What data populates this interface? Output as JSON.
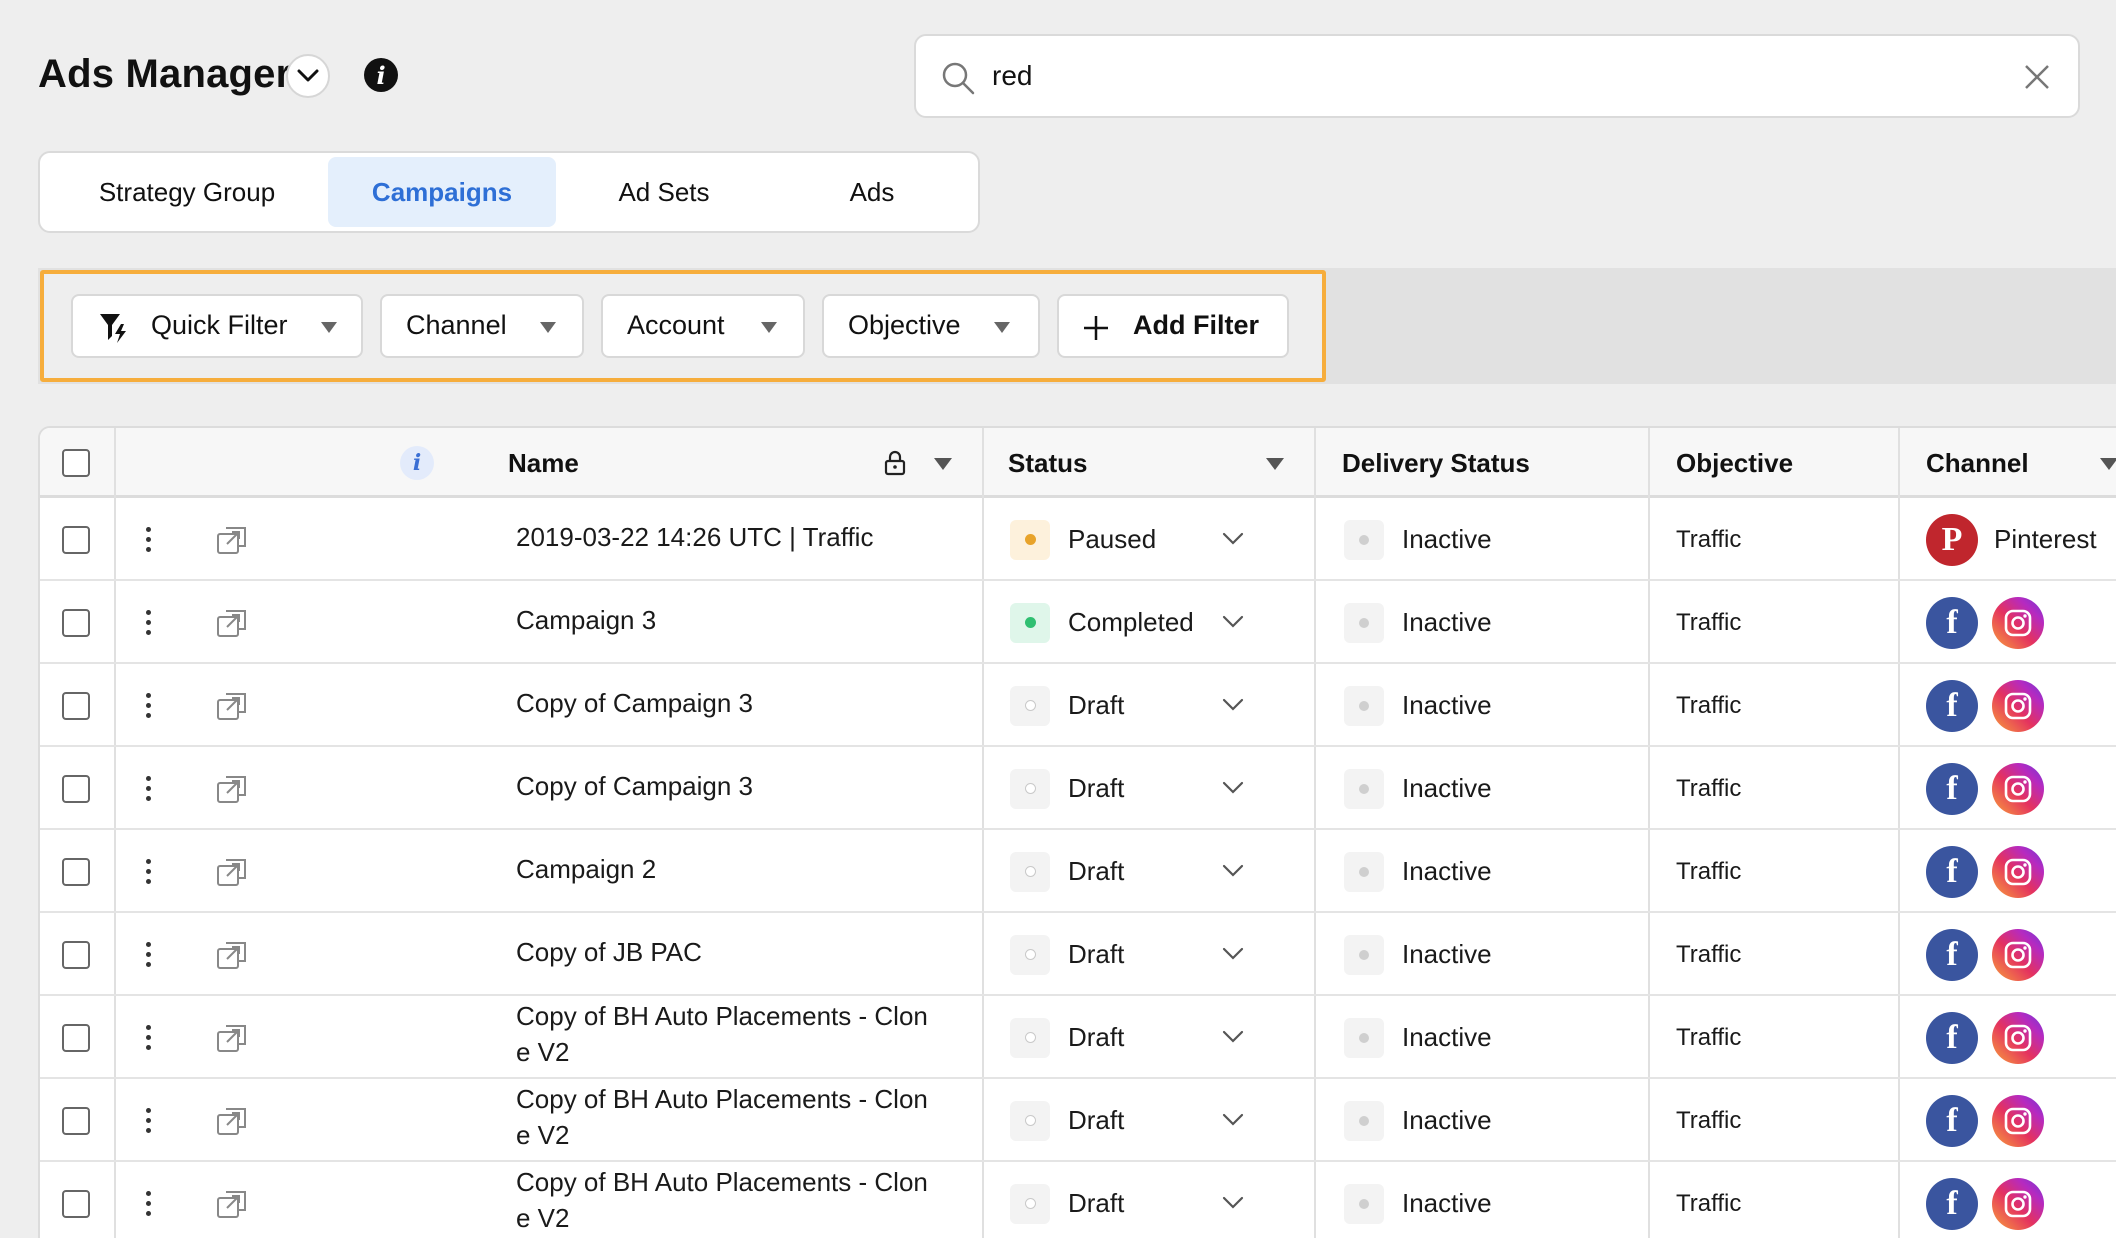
{
  "header": {
    "title": "Ads Manager",
    "search_value": "red"
  },
  "tabs": [
    {
      "label": "Strategy Group",
      "active": false
    },
    {
      "label": "Campaigns",
      "active": true
    },
    {
      "label": "Ad Sets",
      "active": false
    },
    {
      "label": "Ads",
      "active": false
    }
  ],
  "filters": {
    "quick_filter": "Quick Filter",
    "channel": "Channel",
    "account": "Account",
    "objective": "Objective",
    "add_filter": "Add Filter"
  },
  "table": {
    "columns": {
      "name": "Name",
      "status": "Status",
      "delivery_status": "Delivery Status",
      "objective": "Objective",
      "channel": "Channel"
    },
    "rows": [
      {
        "name_line1": "2019-03-22 14:26 UTC | Traffic",
        "name_line2": "",
        "status": "Paused",
        "status_kind": "paused",
        "delivery": "Inactive",
        "objective": "Traffic",
        "channel": "pinterest",
        "channel_label": "Pinterest"
      },
      {
        "name_line1": "Campaign 3",
        "name_line2": "",
        "status": "Completed",
        "status_kind": "completed",
        "delivery": "Inactive",
        "objective": "Traffic",
        "channel": "facebook-instagram",
        "channel_label": ""
      },
      {
        "name_line1": "Copy of Campaign 3",
        "name_line2": "",
        "status": "Draft",
        "status_kind": "draft",
        "delivery": "Inactive",
        "objective": "Traffic",
        "channel": "facebook-instagram",
        "channel_label": ""
      },
      {
        "name_line1": "Copy of Campaign 3",
        "name_line2": "",
        "status": "Draft",
        "status_kind": "draft",
        "delivery": "Inactive",
        "objective": "Traffic",
        "channel": "facebook-instagram",
        "channel_label": ""
      },
      {
        "name_line1": "Campaign 2",
        "name_line2": "",
        "status": "Draft",
        "status_kind": "draft",
        "delivery": "Inactive",
        "objective": "Traffic",
        "channel": "facebook-instagram",
        "channel_label": ""
      },
      {
        "name_line1": "Copy of JB PAC",
        "name_line2": "",
        "status": "Draft",
        "status_kind": "draft",
        "delivery": "Inactive",
        "objective": "Traffic",
        "channel": "facebook-instagram",
        "channel_label": ""
      },
      {
        "name_line1": "Copy of BH Auto Placements - Clon",
        "name_line2": "e V2",
        "status": "Draft",
        "status_kind": "draft",
        "delivery": "Inactive",
        "objective": "Traffic",
        "channel": "facebook-instagram",
        "channel_label": ""
      },
      {
        "name_line1": "Copy of BH Auto Placements - Clon",
        "name_line2": "e V2",
        "status": "Draft",
        "status_kind": "draft",
        "delivery": "Inactive",
        "objective": "Traffic",
        "channel": "facebook-instagram",
        "channel_label": ""
      },
      {
        "name_line1": "Copy of BH Auto Placements - Clon",
        "name_line2": "e V2",
        "status": "Draft",
        "status_kind": "draft",
        "delivery": "Inactive",
        "objective": "Traffic",
        "channel": "facebook-instagram",
        "channel_label": ""
      }
    ]
  },
  "colors": {
    "accent": "#2e6fd6",
    "tab_active_bg": "#e4effc",
    "filter_highlight": "#f6ad3c",
    "paused": "#e8a32a",
    "completed": "#2fbf71",
    "facebook": "#3a559f",
    "pinterest": "#c0262d"
  },
  "icons": {
    "title_dropdown": "chevron-down-icon",
    "info": "info-icon",
    "search": "search-icon",
    "clear": "close-icon",
    "quick_filter": "funnel-lightning-icon",
    "add": "plus-icon",
    "lock": "lock-icon",
    "row_menu": "kebab-menu-icon",
    "open": "open-external-icon"
  }
}
